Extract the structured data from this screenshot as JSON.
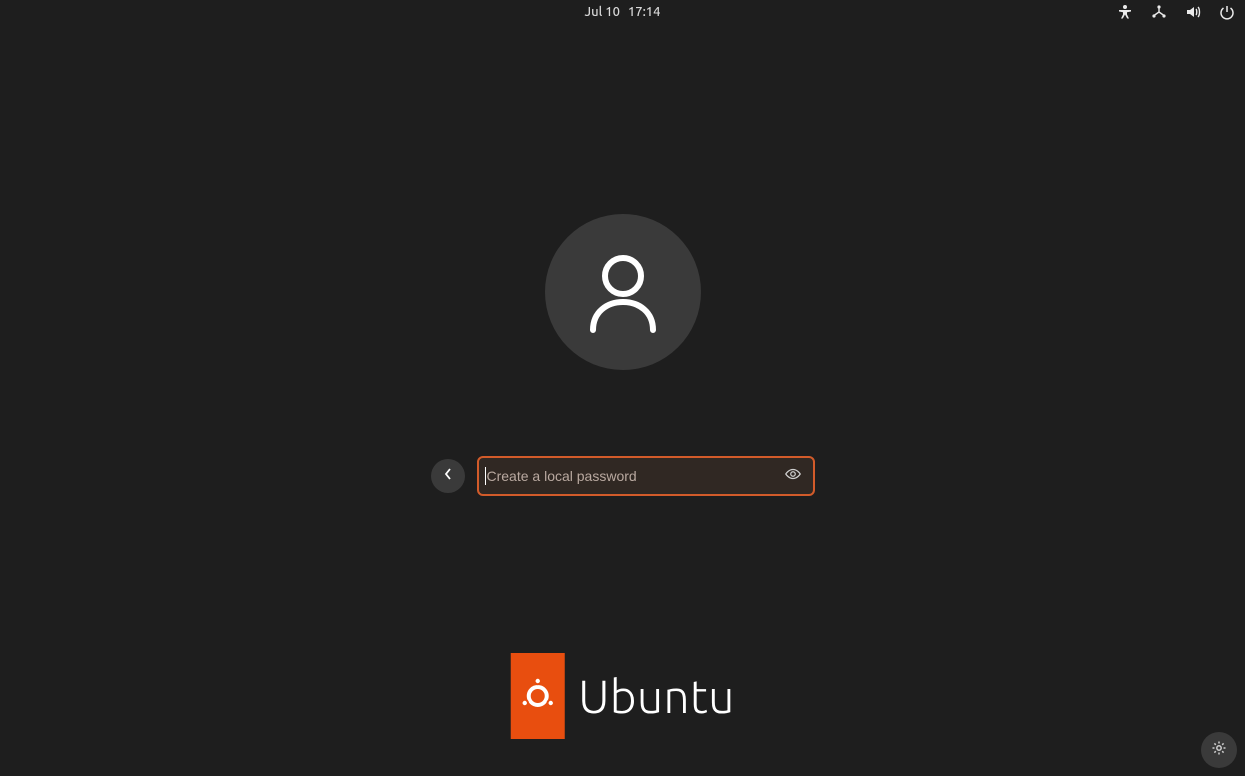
{
  "topbar": {
    "date": "Jul 10",
    "time": "17:14"
  },
  "login": {
    "password_placeholder": "Create a local password",
    "password_value": ""
  },
  "brand": {
    "name": "Ubuntu"
  },
  "colors": {
    "accent": "#e84e0f",
    "focus_border": "#d25b2a",
    "background": "#1e1e1e"
  }
}
